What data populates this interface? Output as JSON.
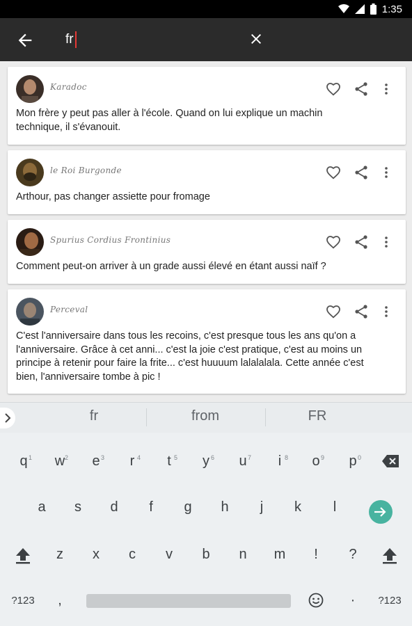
{
  "status_bar": {
    "time": "1:35"
  },
  "search": {
    "value": "fr"
  },
  "quotes": [
    {
      "author": "Karadoc",
      "text": "Mon frère y peut pas aller à l'école. Quand on lui explique un machin technique, il s'évanouit."
    },
    {
      "author": "le Roi Burgonde",
      "text": "Arthour, pas changer assiette pour fromage"
    },
    {
      "author": "Spurius Cordius Frontinius",
      "text": "Comment peut-on arriver à un grade aussi élevé en étant aussi naïf ?"
    },
    {
      "author": "Perceval",
      "text": "C'est l'anniversaire dans tous les recoins, c'est presque tous les ans qu'on a l'anniversaire. Grâce à cet anni... c'est la joie c'est pratique, c'est au moins un principe à retenir pour faire la frite... c'est huuuum lalalalala. Cette année c'est bien, l'anniversaire tombe à pic !"
    }
  ],
  "suggestions": [
    "fr",
    "from",
    "FR"
  ],
  "keyboard": {
    "row1": [
      "q",
      "w",
      "e",
      "r",
      "t",
      "y",
      "u",
      "i",
      "o",
      "p"
    ],
    "row1_hints": [
      "1",
      "2",
      "3",
      "4",
      "5",
      "6",
      "7",
      "8",
      "9",
      "0"
    ],
    "row2": [
      "a",
      "s",
      "d",
      "f",
      "g",
      "h",
      "j",
      "k",
      "l"
    ],
    "row3": [
      "z",
      "x",
      "c",
      "v",
      "b",
      "n",
      "m",
      "!",
      "?"
    ],
    "symbols_left": "?123",
    "comma": ",",
    "period": "·",
    "symbols_right": "?123"
  },
  "colors": {
    "app_bar": "#2b2b2b",
    "caret": "#e53935",
    "enter_key": "#48b3a0"
  }
}
